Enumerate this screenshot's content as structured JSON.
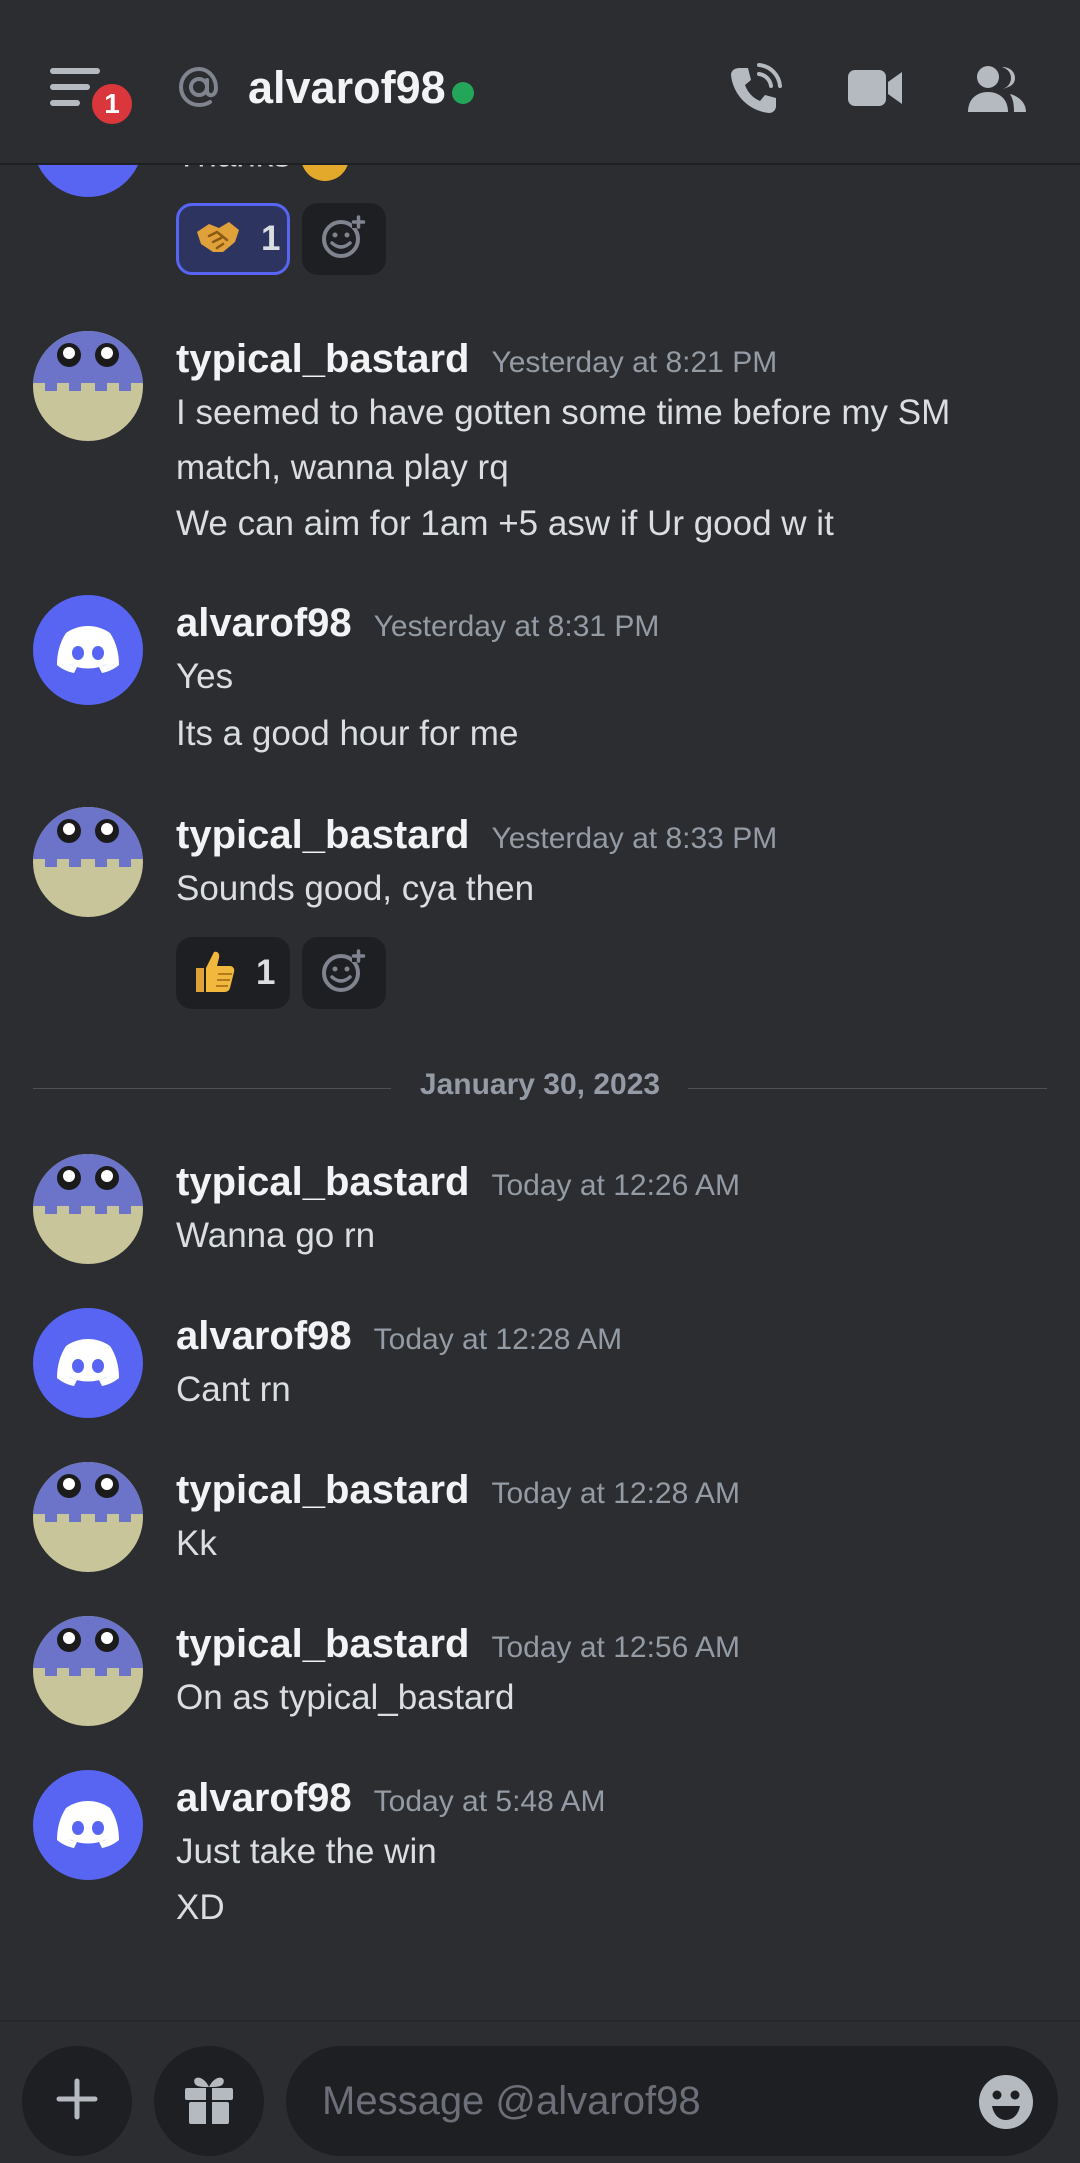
{
  "header": {
    "menu_icon": "hamburger-icon",
    "notification_count": "1",
    "at_icon": "at-sign-icon",
    "title": "alvarof98",
    "status": "online",
    "status_color": "#23a55a",
    "actions": [
      "phone-call-icon",
      "video-camera-icon",
      "members-icon"
    ]
  },
  "previous_message": {
    "partial_text": "Thanks",
    "reactions": [
      {
        "emoji": "handshake",
        "count": "1",
        "active": true
      }
    ]
  },
  "messages": [
    {
      "author": "typical_bastard",
      "avatar": "pixel-avatar",
      "timestamp": "Yesterday at 8:21 PM",
      "lines": [
        "I seemed to have gotten some time before my SM",
        "match, wanna play rq",
        "We can aim for 1am +5 asw if Ur good w it"
      ]
    },
    {
      "author": "alvarof98",
      "avatar": "discord-avatar",
      "timestamp": "Yesterday at 8:31 PM",
      "lines": [
        "Yes",
        "Its a good hour for me"
      ]
    },
    {
      "author": "typical_bastard",
      "avatar": "pixel-avatar",
      "timestamp": "Yesterday at 8:33 PM",
      "lines": [
        "Sounds good, cya then"
      ],
      "reactions": [
        {
          "emoji": "thumbs-up",
          "count": "1",
          "active": false
        }
      ]
    },
    {
      "author": "typical_bastard",
      "avatar": "pixel-avatar",
      "timestamp": "Today at 12:26 AM",
      "lines": [
        "Wanna go rn"
      ]
    },
    {
      "author": "alvarof98",
      "avatar": "discord-avatar",
      "timestamp": "Today at 12:28 AM",
      "lines": [
        "Cant rn"
      ]
    },
    {
      "author": "typical_bastard",
      "avatar": "pixel-avatar",
      "timestamp": "Today at 12:28 AM",
      "lines": [
        "Kk"
      ]
    },
    {
      "author": "typical_bastard",
      "avatar": "pixel-avatar",
      "timestamp": "Today at 12:56 AM",
      "lines": [
        "On as typical_bastard"
      ]
    },
    {
      "author": "alvarof98",
      "avatar": "discord-avatar",
      "timestamp": "Today at 5:48 AM",
      "lines": [
        "Just take the win",
        "XD"
      ]
    }
  ],
  "date_divider": "January 30, 2023",
  "composer": {
    "placeholder": "Message @alvarof98",
    "buttons": [
      "plus-icon",
      "gift-icon",
      "emoji-icon"
    ]
  },
  "colors": {
    "background": "#2b2d31",
    "accent": "#5865f2",
    "badge": "#da373c"
  }
}
